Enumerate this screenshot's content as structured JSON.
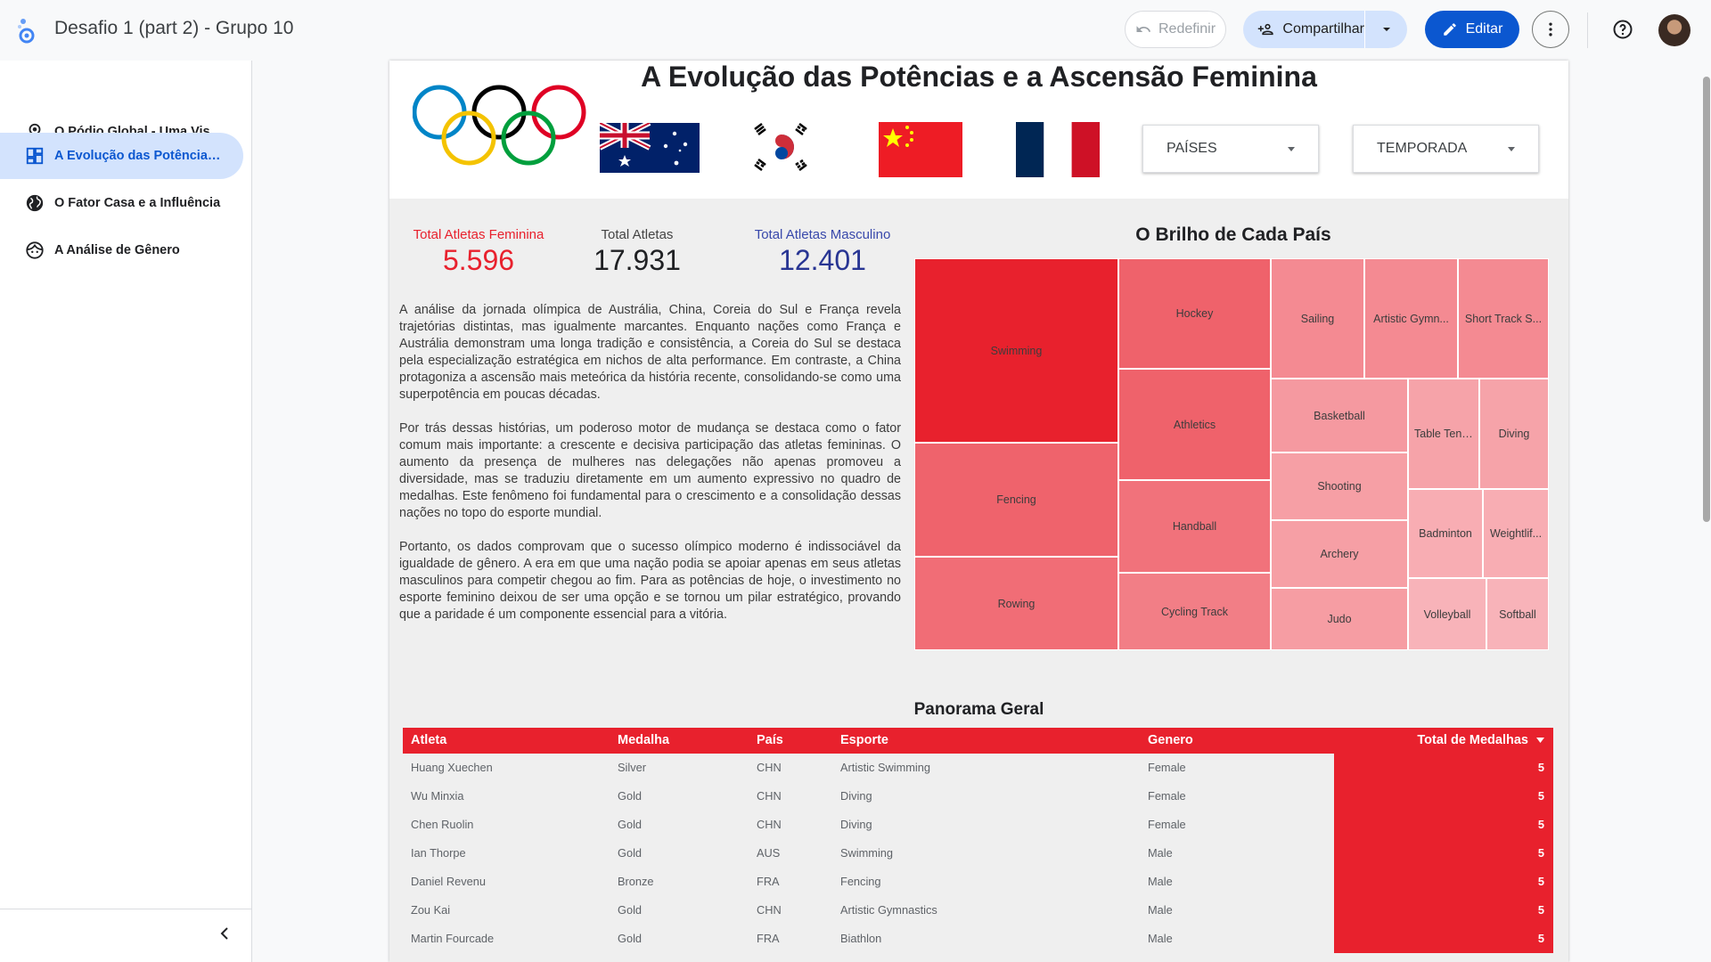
{
  "app": {
    "doc_title": "Desafio 1 (part 2) - Grupo 10",
    "reset_label": "Redefinir",
    "share_label": "Compartilhar",
    "edit_label": "Editar"
  },
  "sidebar": {
    "items": [
      {
        "label": "O Pódio Global - Uma Visão Geral",
        "icon": "award-icon"
      },
      {
        "label": "A Evolução das Potências e a Ascensão Feminina",
        "icon": "dashboard-icon",
        "active": true
      },
      {
        "label": "O Fator Casa e a Influência",
        "icon": "globe-icon"
      },
      {
        "label": "A Análise de Gênero",
        "icon": "face-icon"
      }
    ]
  },
  "report": {
    "title": "A Evolução das Potências e a Ascensão Feminina",
    "flags": [
      "australia-flag",
      "south-korea-flag",
      "china-flag",
      "france-flag"
    ],
    "filters": {
      "countries": "PAÍSES",
      "season": "TEMPORADA"
    },
    "kpis": {
      "female_label": "Total Atletas Feminina",
      "female_value": "5.596",
      "total_label": "Total Atletas",
      "total_value": "17.931",
      "male_label": "Total Atletas Masculino",
      "male_value": "12.401"
    },
    "paragraphs": [
      "A análise da jornada olímpica de Austrália, China, Coreia do Sul e França revela trajetórias distintas, mas igualmente marcantes. Enquanto nações como França e Austrália demonstram uma longa tradição e consistência, a Coreia do Sul se destaca pela especialização estratégica em nichos de alta performance. Em contraste, a China protagoniza a ascensão mais meteórica da história recente, consolidando-se como uma superpotência em poucas décadas.",
      "Por trás dessas histórias, um poderoso motor de mudança se destaca como o fator comum mais importante: a crescente e decisiva participação das atletas femininas. O aumento da presença de mulheres nas delegações não apenas promoveu a diversidade, mas se traduziu diretamente em um aumento expressivo no quadro de medalhas. Este fenômeno foi fundamental para o crescimento e a consolidação dessas nações no topo do esporte mundial.",
      "Portanto, os dados comprovam que o sucesso olímpico moderno é indissociável da igualdade de gênero. A era em que uma nação podia se apoiar apenas em seus atletas masculinos para competir chegou ao fim. Para as potências de hoje, o investimento no esporte feminino deixou de ser uma opção e se tornou um pilar estratégico, provando que a paridade é um componente essencial para a vitória."
    ],
    "treemap_title": "O Brilho de Cada País",
    "table_title": "Panorama Geral"
  },
  "chart_data": {
    "type": "treemap",
    "title": "O Brilho de Cada País",
    "categories": [
      "Swimming",
      "Fencing",
      "Rowing",
      "Hockey",
      "Athletics",
      "Handball",
      "Cycling Track",
      "Sailing",
      "Artistic Gymn...",
      "Short Track S...",
      "Basketball",
      "Shooting",
      "Archery",
      "Judo",
      "Table Tennis",
      "Diving",
      "Badminton",
      "Weightlif...",
      "Volleyball",
      "Softball"
    ],
    "values": [
      100,
      56,
      50,
      57,
      57,
      47,
      40,
      33,
      33,
      33,
      25,
      22,
      22,
      23,
      20,
      20,
      15,
      15,
      12,
      12
    ]
  },
  "table": {
    "headers": {
      "athlete": "Atleta",
      "medal": "Medalha",
      "country": "País",
      "sport": "Esporte",
      "gender": "Genero",
      "total": "Total de Medalhas"
    },
    "rows": [
      {
        "athlete": "Huang Xuechen",
        "medal": "Silver",
        "country": "CHN",
        "sport": "Artistic Swimming",
        "gender": "Female",
        "total": "5"
      },
      {
        "athlete": "Wu Minxia",
        "medal": "Gold",
        "country": "CHN",
        "sport": "Diving",
        "gender": "Female",
        "total": "5"
      },
      {
        "athlete": "Chen Ruolin",
        "medal": "Gold",
        "country": "CHN",
        "sport": "Diving",
        "gender": "Female",
        "total": "5"
      },
      {
        "athlete": "Ian Thorpe",
        "medal": "Gold",
        "country": "AUS",
        "sport": "Swimming",
        "gender": "Male",
        "total": "5"
      },
      {
        "athlete": "Daniel Revenu",
        "medal": "Bronze",
        "country": "FRA",
        "sport": "Fencing",
        "gender": "Male",
        "total": "5"
      },
      {
        "athlete": "Zou Kai",
        "medal": "Gold",
        "country": "CHN",
        "sport": "Artistic Gymnastics",
        "gender": "Male",
        "total": "5"
      },
      {
        "athlete": "Martin Fourcade",
        "medal": "Gold",
        "country": "FRA",
        "sport": "Biathlon",
        "gender": "Male",
        "total": "5"
      }
    ]
  },
  "colors": {
    "accent": "#0b57d0",
    "brand_red": "#e8212d",
    "female": "#e8212d",
    "male": "#283593"
  }
}
